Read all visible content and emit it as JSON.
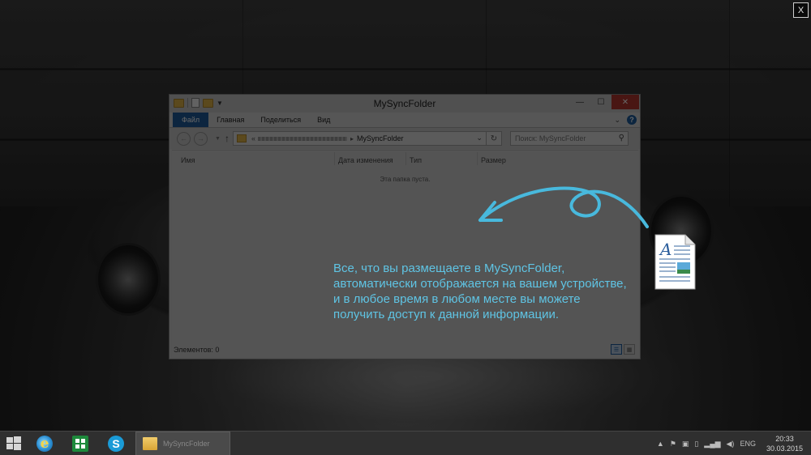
{
  "tour": {
    "close_label": "X",
    "message": "Все, что вы размещаете в MySyncFolder, автоматически отображается на вашем устройстве, и в любое время в любом месте вы можете получить доступ к данной информации."
  },
  "window": {
    "title": "MySyncFolder",
    "close_glyph": "✕",
    "ribbon_tabs": [
      "Файл",
      "Главная",
      "Поделиться",
      "Вид"
    ],
    "help_glyph": "?",
    "address": {
      "lead": "«",
      "current": "MySyncFolder"
    },
    "search_placeholder": "Поиск: MySyncFolder",
    "columns": [
      "Имя",
      "Дата изменения",
      "Тип",
      "Размер"
    ],
    "empty_message": "Эта папка пуста.",
    "status": "Элементов: 0"
  },
  "taskbar": {
    "explorer_label": "MySyncFolder",
    "language": "ENG",
    "time": "20:33",
    "date": "30.03.2015"
  },
  "colors": {
    "accent_blue": "#1f5f9e",
    "tour_text": "#5fc4e4",
    "close_red": "#b73a32"
  },
  "icons": {
    "start": "windows-logo-icon",
    "browser": "internet-explorer-icon",
    "store": "store-icon",
    "skype": "skype-icon",
    "explorer": "folder-icon",
    "document": "document-icon"
  }
}
